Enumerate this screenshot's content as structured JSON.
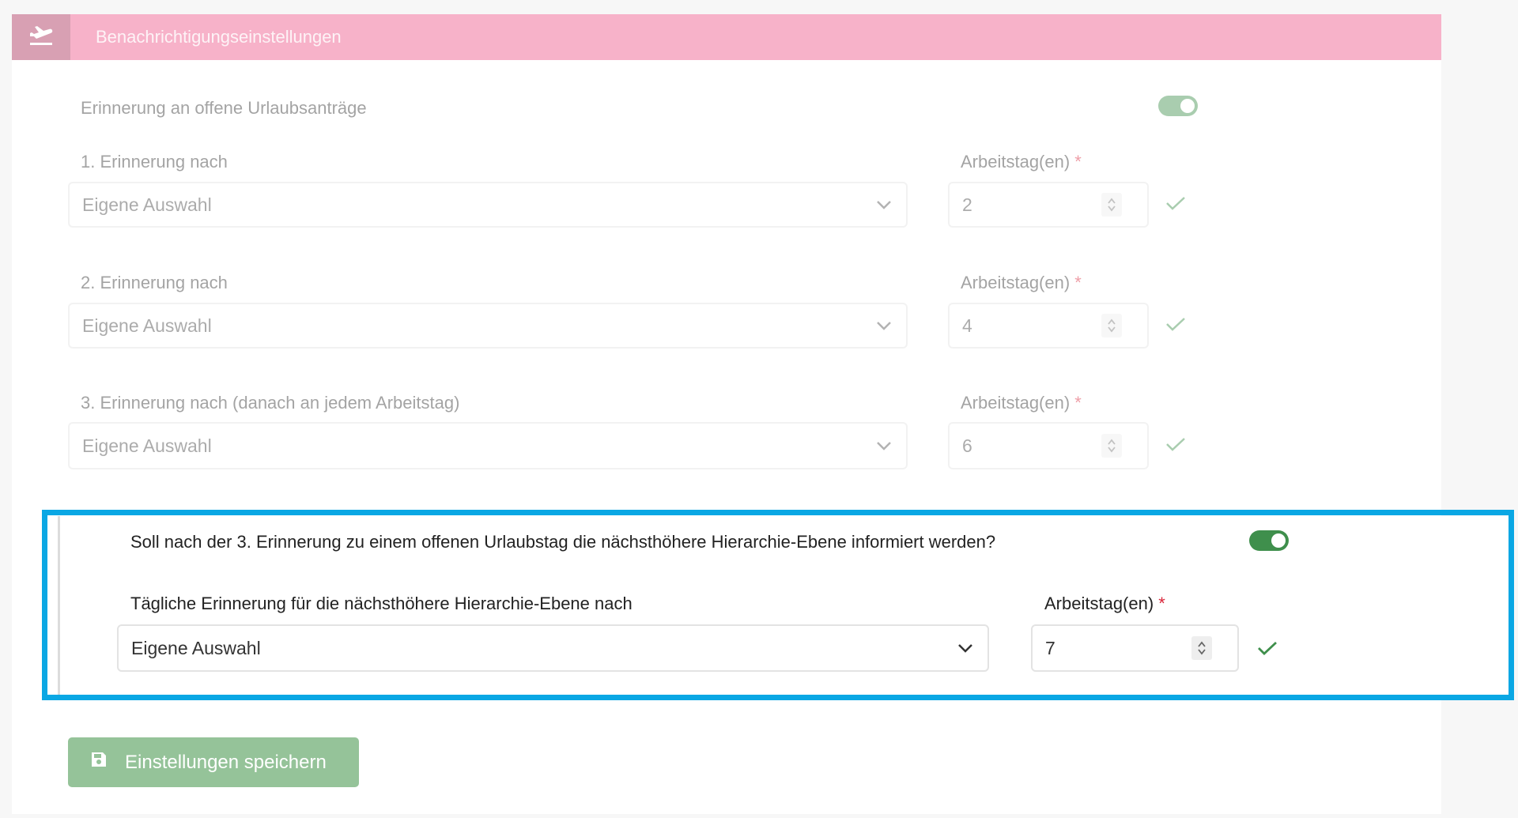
{
  "header": {
    "title": "Benachrichtigungseinstellungen",
    "icon": "airplane-departure-icon",
    "color": "#f7b2c9"
  },
  "reminder_toggle": {
    "label": "Erinnerung an offene Urlaubsanträge",
    "on": true
  },
  "reminders": [
    {
      "label": "1. Erinnerung nach",
      "select_value": "Eigene Auswahl",
      "days_label": "Arbeitstag(en)",
      "required_mark": "*",
      "days_value": "2"
    },
    {
      "label": "2. Erinnerung nach",
      "select_value": "Eigene Auswahl",
      "days_label": "Arbeitstag(en)",
      "required_mark": "*",
      "days_value": "4"
    },
    {
      "label": "3. Erinnerung nach (danach an jedem Arbeitstag)",
      "select_value": "Eigene Auswahl",
      "days_label": "Arbeitstag(en)",
      "required_mark": "*",
      "days_value": "6"
    }
  ],
  "escalation": {
    "question": "Soll nach der 3. Erinnerung zu einem offenen Urlaubstag die nächsthöhere Hierarchie-Ebene informiert werden?",
    "on": true,
    "daily_label": "Tägliche Erinnerung für die nächsthöhere Hierarchie-Ebene nach",
    "select_value": "Eigene Auswahl",
    "days_label": "Arbeitstag(en)",
    "required_mark": "*",
    "days_value": "7",
    "highlight_color": "#0aa7e4"
  },
  "save_button": {
    "label": "Einstellungen speichern",
    "icon": "save-icon",
    "color": "#95c399"
  },
  "colors": {
    "toggle_on": "#3f8f4c",
    "check": "#3f8f4c",
    "required": "#d9253a"
  }
}
